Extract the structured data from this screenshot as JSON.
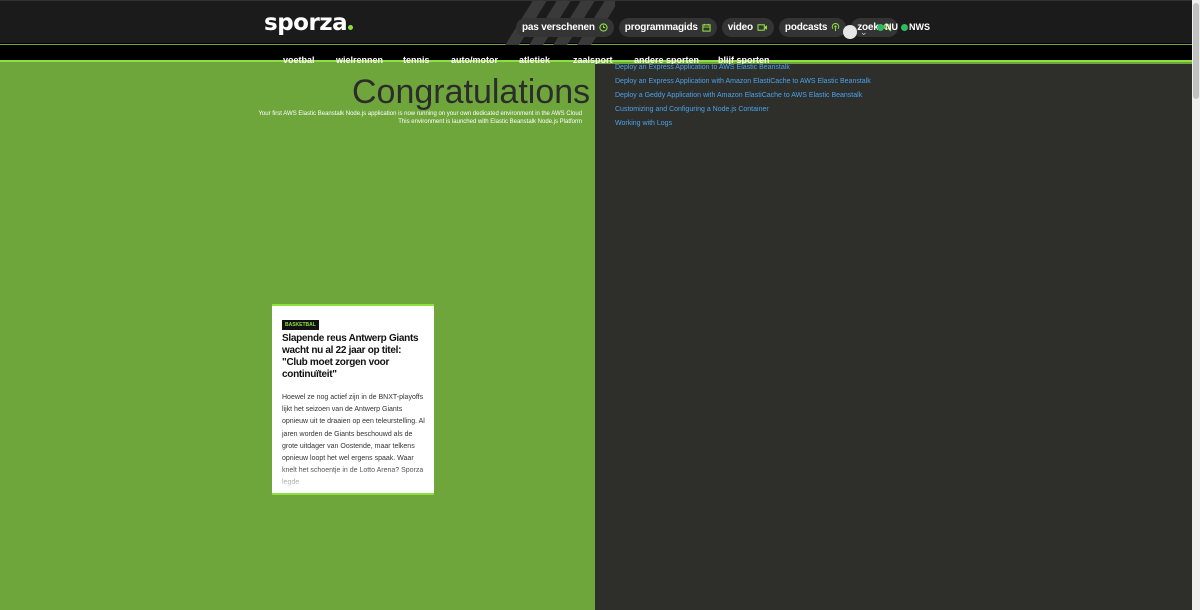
{
  "header": {
    "logo": "sporza",
    "nav": [
      {
        "label": "pas verschenen",
        "icon": "clock-icon"
      },
      {
        "label": "programmagids",
        "icon": "calendar-icon"
      },
      {
        "label": "video",
        "icon": "video-icon"
      },
      {
        "label": "podcasts",
        "icon": "podcast-icon"
      },
      {
        "label": "zoek",
        "icon": "search-icon"
      }
    ],
    "brands": [
      "NU",
      "NWS"
    ]
  },
  "categories": [
    "voetbal",
    "wielrennen",
    "tennis",
    "auto/motor",
    "atletiek",
    "zaalsport",
    "andere sporten",
    "blijf sporten"
  ],
  "congrats": {
    "title": "Congratulations",
    "line1": "Your first AWS Elastic Beanstalk Node.js application is now running on your own dedicated environment in the AWS Cloud",
    "line2": "This environment is launched with Elastic Beanstalk Node.js Platform"
  },
  "links": [
    "Deploy an Express Application to AWS Elastic Beanstalk",
    "Deploy an Express Application with Amazon ElastiCache to AWS Elastic Beanstalk",
    "Deploy a Geddy Application with Amazon ElastiCache to AWS Elastic Beanstalk",
    "Customizing and Configuring a Node.js Container",
    "Working with Logs"
  ],
  "article": {
    "tag": "BASKETBAL",
    "title": "Slapende reus Antwerp Giants wacht nu al 22 jaar op titel: \"Club moet zorgen voor continuïteit\"",
    "body": "Hoewel ze nog actief zijn in de BNXT-playoffs lijkt het seizoen van de Antwerp Giants opnieuw uit te draaien op een teleurstelling. Al jaren worden de Giants beschouwd als de grote uitdager van Oostende, maar telkens opnieuw loopt het wel ergens spaak. Waar knelt het schoentje in de Lotto Arena? Sporza legde"
  },
  "colors": {
    "accent": "#8de03d",
    "page_bg": "#6fa63b",
    "dark_panel": "#2e2e2b",
    "link": "#4aa3ea"
  }
}
